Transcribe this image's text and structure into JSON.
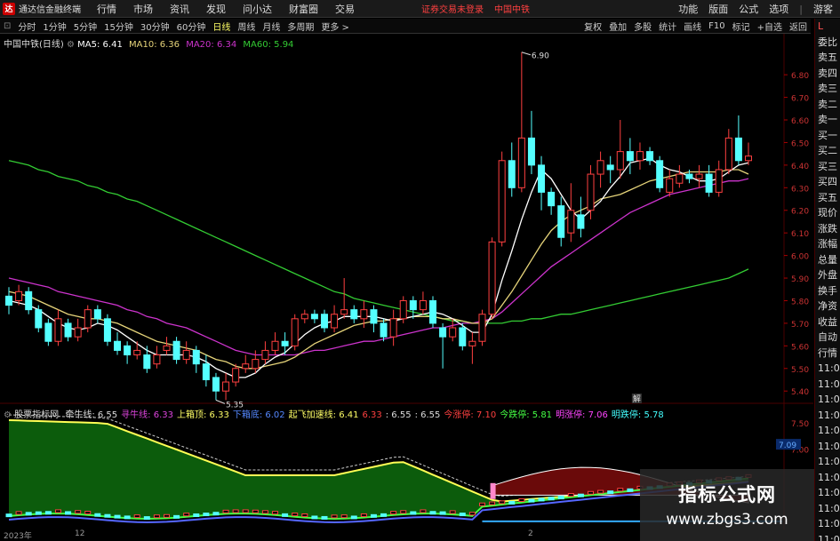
{
  "window": {
    "logo_text": "达",
    "title": "通达信金融终端",
    "menus": [
      "行情",
      "市场",
      "资讯",
      "发现",
      "问小达",
      "财富圈",
      "交易"
    ],
    "warning": "证券交易未登录",
    "stock_name": "中国中铁",
    "right_menus": [
      "功能",
      "版面",
      "公式",
      "选项"
    ],
    "guest": "游客",
    "controls": [
      "–",
      "▫",
      "×"
    ]
  },
  "toolbar": {
    "periods": [
      "分时",
      "1分钟",
      "5分钟",
      "15分钟",
      "30分钟",
      "60分钟",
      "日线",
      "周线",
      "月线",
      "多周期",
      "更多 >"
    ],
    "active_period": "日线",
    "right_buttons": [
      "复权",
      "叠加",
      "多股",
      "统计",
      "画线",
      "F10",
      "标记",
      "+自选",
      "返回"
    ]
  },
  "chart_header": {
    "name": "中国中铁(日线)",
    "ma5": "MA5: 6.41",
    "ma10": "MA10: 6.36",
    "ma20": "MA20: 6.34",
    "ma60": "MA60: 5.94"
  },
  "colors": {
    "up": "#ff4040",
    "down": "#54ffff",
    "ma5": "#ffffff",
    "ma10": "#e6d47a",
    "ma20": "#cc33cc",
    "ma60": "#33cc33",
    "grid": "#4a0000"
  },
  "chart_data": {
    "type": "candlestick",
    "y_axis_ticks": [
      "6.80",
      "6.70",
      "6.60",
      "6.50",
      "6.40",
      "6.30",
      "6.20",
      "6.10",
      "6.00",
      "5.90",
      "5.80",
      "5.70",
      "5.60",
      "5.50",
      "5.40"
    ],
    "ylim": [
      5.35,
      6.9
    ],
    "annotations": {
      "high": "6.90",
      "low": "5.35"
    },
    "candles": [
      [
        5.82,
        5.78,
        5.86,
        5.74
      ],
      [
        5.8,
        5.84,
        5.87,
        5.78
      ],
      [
        5.84,
        5.76,
        5.86,
        5.74
      ],
      [
        5.76,
        5.68,
        5.78,
        5.66
      ],
      [
        5.7,
        5.62,
        5.72,
        5.6
      ],
      [
        5.62,
        5.72,
        5.76,
        5.6
      ],
      [
        5.7,
        5.64,
        5.72,
        5.62
      ],
      [
        5.64,
        5.68,
        5.72,
        5.62
      ],
      [
        5.68,
        5.76,
        5.78,
        5.66
      ],
      [
        5.76,
        5.72,
        5.78,
        5.7
      ],
      [
        5.72,
        5.62,
        5.74,
        5.6
      ],
      [
        5.62,
        5.58,
        5.66,
        5.56
      ],
      [
        5.6,
        5.56,
        5.62,
        5.52
      ],
      [
        5.56,
        5.58,
        5.62,
        5.54
      ],
      [
        5.56,
        5.5,
        5.6,
        5.48
      ],
      [
        5.52,
        5.56,
        5.6,
        5.5
      ],
      [
        5.58,
        5.6,
        5.64,
        5.56
      ],
      [
        5.62,
        5.54,
        5.64,
        5.52
      ],
      [
        5.54,
        5.58,
        5.62,
        5.52
      ],
      [
        5.58,
        5.52,
        5.6,
        5.48
      ],
      [
        5.52,
        5.45,
        5.56,
        5.42
      ],
      [
        5.46,
        5.4,
        5.48,
        5.36
      ],
      [
        5.4,
        5.44,
        5.48,
        5.36
      ],
      [
        5.44,
        5.5,
        5.52,
        5.42
      ],
      [
        5.5,
        5.52,
        5.56,
        5.48
      ],
      [
        5.5,
        5.54,
        5.58,
        5.48
      ],
      [
        5.54,
        5.58,
        5.62,
        5.52
      ],
      [
        5.58,
        5.62,
        5.66,
        5.56
      ],
      [
        5.62,
        5.6,
        5.66,
        5.56
      ],
      [
        5.6,
        5.72,
        5.74,
        5.58
      ],
      [
        5.72,
        5.74,
        5.76,
        5.7
      ],
      [
        5.74,
        5.72,
        5.76,
        5.7
      ],
      [
        5.74,
        5.68,
        5.76,
        5.66
      ],
      [
        5.68,
        5.74,
        5.78,
        5.66
      ],
      [
        5.74,
        5.76,
        5.9,
        5.72
      ],
      [
        5.76,
        5.72,
        5.78,
        5.7
      ],
      [
        5.72,
        5.76,
        5.8,
        5.68
      ],
      [
        5.76,
        5.7,
        5.78,
        5.66
      ],
      [
        5.7,
        5.64,
        5.72,
        5.62
      ],
      [
        5.64,
        5.72,
        5.76,
        5.6
      ],
      [
        5.72,
        5.8,
        5.82,
        5.7
      ],
      [
        5.8,
        5.76,
        5.82,
        5.72
      ],
      [
        5.76,
        5.8,
        5.84,
        5.74
      ],
      [
        5.8,
        5.7,
        5.82,
        5.68
      ],
      [
        5.68,
        5.64,
        5.7,
        5.5
      ],
      [
        5.64,
        5.68,
        5.72,
        5.62
      ],
      [
        5.68,
        5.6,
        5.7,
        5.58
      ],
      [
        5.6,
        5.62,
        5.66,
        5.52
      ],
      [
        5.62,
        5.74,
        5.76,
        5.6
      ],
      [
        5.74,
        6.06,
        6.08,
        5.72
      ],
      [
        6.06,
        6.42,
        6.46,
        6.04
      ],
      [
        6.42,
        6.3,
        6.5,
        6.26
      ],
      [
        6.3,
        6.52,
        6.9,
        6.28
      ],
      [
        6.52,
        6.4,
        6.64,
        6.36
      ],
      [
        6.4,
        6.28,
        6.44,
        6.2
      ],
      [
        6.28,
        6.22,
        6.3,
        6.18
      ],
      [
        6.22,
        6.08,
        6.26,
        6.04
      ],
      [
        6.1,
        6.2,
        6.32,
        6.06
      ],
      [
        6.18,
        6.12,
        6.26,
        6.08
      ],
      [
        6.2,
        6.36,
        6.4,
        6.16
      ],
      [
        6.36,
        6.42,
        6.46,
        6.3
      ],
      [
        6.4,
        6.38,
        6.44,
        6.32
      ],
      [
        6.38,
        6.46,
        6.6,
        6.34
      ],
      [
        6.46,
        6.42,
        6.52,
        6.36
      ],
      [
        6.42,
        6.46,
        6.5,
        6.38
      ],
      [
        6.46,
        6.42,
        6.48,
        6.4
      ],
      [
        6.42,
        6.3,
        6.44,
        6.28
      ],
      [
        6.28,
        6.34,
        6.38,
        6.26
      ],
      [
        6.32,
        6.36,
        6.4,
        6.3
      ],
      [
        6.36,
        6.34,
        6.38,
        6.32
      ],
      [
        6.34,
        6.36,
        6.4,
        6.3
      ],
      [
        6.36,
        6.28,
        6.4,
        6.26
      ],
      [
        6.28,
        6.38,
        6.42,
        6.26
      ],
      [
        6.38,
        6.52,
        6.56,
        6.36
      ],
      [
        6.52,
        6.42,
        6.62,
        6.4
      ],
      [
        6.42,
        6.44,
        6.5,
        6.4
      ]
    ],
    "ma5": [
      5.8,
      5.79,
      5.78,
      5.76,
      5.73,
      5.7,
      5.68,
      5.67,
      5.68,
      5.7,
      5.69,
      5.67,
      5.64,
      5.61,
      5.58,
      5.56,
      5.56,
      5.56,
      5.56,
      5.55,
      5.53,
      5.5,
      5.48,
      5.46,
      5.46,
      5.48,
      5.52,
      5.55,
      5.57,
      5.61,
      5.65,
      5.68,
      5.7,
      5.71,
      5.73,
      5.73,
      5.73,
      5.73,
      5.72,
      5.71,
      5.72,
      5.73,
      5.74,
      5.75,
      5.74,
      5.72,
      5.69,
      5.66,
      5.66,
      5.74,
      5.89,
      6.02,
      6.16,
      6.28,
      6.38,
      6.34,
      6.27,
      6.2,
      6.16,
      6.2,
      6.24,
      6.3,
      6.35,
      6.41,
      6.42,
      6.43,
      6.4,
      6.38,
      6.37,
      6.35,
      6.33,
      6.33,
      6.34,
      6.37,
      6.4,
      6.41
    ],
    "ma10": [
      5.84,
      5.83,
      5.82,
      5.8,
      5.78,
      5.76,
      5.74,
      5.73,
      5.72,
      5.72,
      5.71,
      5.7,
      5.68,
      5.66,
      5.64,
      5.62,
      5.61,
      5.6,
      5.59,
      5.58,
      5.56,
      5.54,
      5.53,
      5.51,
      5.5,
      5.5,
      5.51,
      5.52,
      5.53,
      5.55,
      5.58,
      5.61,
      5.63,
      5.65,
      5.67,
      5.69,
      5.7,
      5.71,
      5.71,
      5.72,
      5.72,
      5.73,
      5.73,
      5.73,
      5.72,
      5.72,
      5.71,
      5.7,
      5.7,
      5.72,
      5.78,
      5.84,
      5.91,
      5.98,
      6.05,
      6.11,
      6.15,
      6.18,
      6.2,
      6.22,
      6.25,
      6.26,
      6.27,
      6.29,
      6.31,
      6.33,
      6.34,
      6.35,
      6.36,
      6.37,
      6.37,
      6.37,
      6.37,
      6.38,
      6.38,
      6.36
    ],
    "ma20": [
      5.9,
      5.89,
      5.88,
      5.87,
      5.86,
      5.84,
      5.83,
      5.82,
      5.81,
      5.8,
      5.79,
      5.78,
      5.76,
      5.75,
      5.73,
      5.72,
      5.7,
      5.69,
      5.68,
      5.66,
      5.64,
      5.62,
      5.6,
      5.58,
      5.57,
      5.56,
      5.56,
      5.56,
      5.56,
      5.56,
      5.57,
      5.58,
      5.58,
      5.59,
      5.6,
      5.61,
      5.62,
      5.62,
      5.63,
      5.64,
      5.65,
      5.66,
      5.67,
      5.68,
      5.68,
      5.69,
      5.7,
      5.7,
      5.71,
      5.72,
      5.75,
      5.79,
      5.83,
      5.87,
      5.91,
      5.95,
      5.98,
      6.01,
      6.04,
      6.07,
      6.1,
      6.13,
      6.16,
      6.19,
      6.21,
      6.23,
      6.25,
      6.27,
      6.28,
      6.29,
      6.3,
      6.31,
      6.32,
      6.33,
      6.33,
      6.34
    ],
    "ma60": [
      6.42,
      6.41,
      6.4,
      6.38,
      6.37,
      6.35,
      6.34,
      6.33,
      6.31,
      6.3,
      6.28,
      6.27,
      6.25,
      6.24,
      6.22,
      6.2,
      6.18,
      6.16,
      6.14,
      6.12,
      6.1,
      6.08,
      6.06,
      6.04,
      6.02,
      6.0,
      5.98,
      5.96,
      5.94,
      5.92,
      5.9,
      5.88,
      5.86,
      5.84,
      5.83,
      5.81,
      5.8,
      5.79,
      5.78,
      5.77,
      5.76,
      5.75,
      5.74,
      5.73,
      5.72,
      5.71,
      5.71,
      5.7,
      5.7,
      5.7,
      5.7,
      5.71,
      5.71,
      5.72,
      5.72,
      5.73,
      5.74,
      5.74,
      5.75,
      5.76,
      5.77,
      5.78,
      5.79,
      5.8,
      5.81,
      5.82,
      5.83,
      5.84,
      5.85,
      5.86,
      5.87,
      5.88,
      5.89,
      5.9,
      5.92,
      5.94
    ]
  },
  "indicator": {
    "name": "股票指标网",
    "items": [
      {
        "label": "牵牛线: 6.55",
        "color": "#dddddd"
      },
      {
        "label": "寻牛线: 6.33",
        "color": "#dd44dd"
      },
      {
        "label": "上箱顶: 6.33",
        "color": "#ffff66"
      },
      {
        "label": "下箱底: 6.02",
        "color": "#5588ff"
      },
      {
        "label": "起飞加速线: 6.41",
        "color": "#ffff66"
      },
      {
        "label": "6.33",
        "color": "#ff4040"
      },
      {
        "label": ": 6.55",
        "color": "#dddddd"
      },
      {
        "label": ": 6.55",
        "color": "#dddddd"
      },
      {
        "label": "今涨停: 7.10",
        "color": "#ff4040"
      },
      {
        "label": "今跌停: 5.81",
        "color": "#44ff44"
      },
      {
        "label": "明涨停: 7.06",
        "color": "#ff44ff"
      },
      {
        "label": "明跌停: 5.78",
        "color": "#44ffff"
      }
    ],
    "y_ticks": [
      "7.50",
      "7.09",
      "7.00"
    ],
    "tag": "7.09"
  },
  "sidebar": {
    "top": "L",
    "items": [
      "委比",
      "卖五",
      "卖四",
      "卖三",
      "卖二",
      "卖一",
      "买一",
      "买二",
      "买三",
      "买四",
      "买五",
      "现价",
      "涨跌",
      "涨幅",
      "总量",
      "外盘",
      "换手",
      "净资",
      "收益",
      "自动",
      "行情",
      "11:0",
      "11:0",
      "11:0",
      "11:0",
      "11:0",
      "11:0",
      "11:0",
      "11:0",
      "11:0",
      "11:0",
      "11:0",
      "11:0"
    ]
  },
  "dates": [
    "2023年",
    "12",
    "2"
  ],
  "watermark": {
    "title": "指标公式网",
    "url": "www.zbgs3.com"
  },
  "misc": {
    "jie": "解"
  }
}
